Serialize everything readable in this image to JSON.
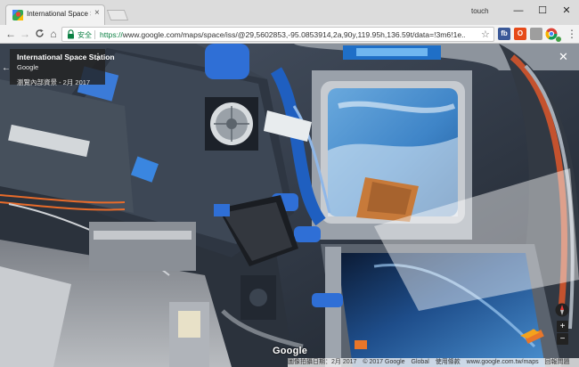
{
  "browser": {
    "tab_title": "International Space Statio",
    "tab_close": "×",
    "profile_label": "touch",
    "window_controls": {
      "minimize": "—",
      "maximize": "☐",
      "close": "✕"
    },
    "toolbar": {
      "back": "←",
      "forward": "→",
      "reload": "C",
      "home": "⌂",
      "secure_label": "安全",
      "url_scheme": "https://",
      "url_rest": "www.google.com/maps/space/iss/@29,5602853,-95.0853914,2a,90y,119.95h,136.59t/data=!3m6!1e...",
      "star": "☆",
      "extensions": [
        {
          "name": "facebook-extension",
          "label": "fb",
          "color": "#3b5998"
        },
        {
          "name": "office-extension",
          "label": "O",
          "color": "#e64a19"
        },
        {
          "name": "grey-extension",
          "label": "",
          "color": "#9e9e9e"
        },
        {
          "name": "chrome-extension",
          "label": "",
          "color": "#4285f4"
        },
        {
          "name": "green-extension",
          "label": "",
          "color": "#43a047"
        }
      ],
      "menu": "⋮"
    }
  },
  "street_view": {
    "place_title": "International Space Station",
    "place_source": "Google",
    "capture_date": "瀏覽內部資景 - 2月 2017",
    "more_icon": "⋮",
    "back_icon": "←",
    "close_icon": "✕",
    "zoom_in": "+",
    "zoom_out": "−",
    "google_logo": "Google",
    "attribution": [
      "圖像拍攝日期：2月 2017",
      "© 2017 Google",
      "Global",
      "使用條款",
      "www.google.com.tw/maps",
      "回報問題"
    ]
  },
  "colors": {
    "secure_green": "#0b8043",
    "panel_dark": "#222222",
    "earth_blue": "#3f85c8",
    "module_blue": "#2f6fd6"
  }
}
